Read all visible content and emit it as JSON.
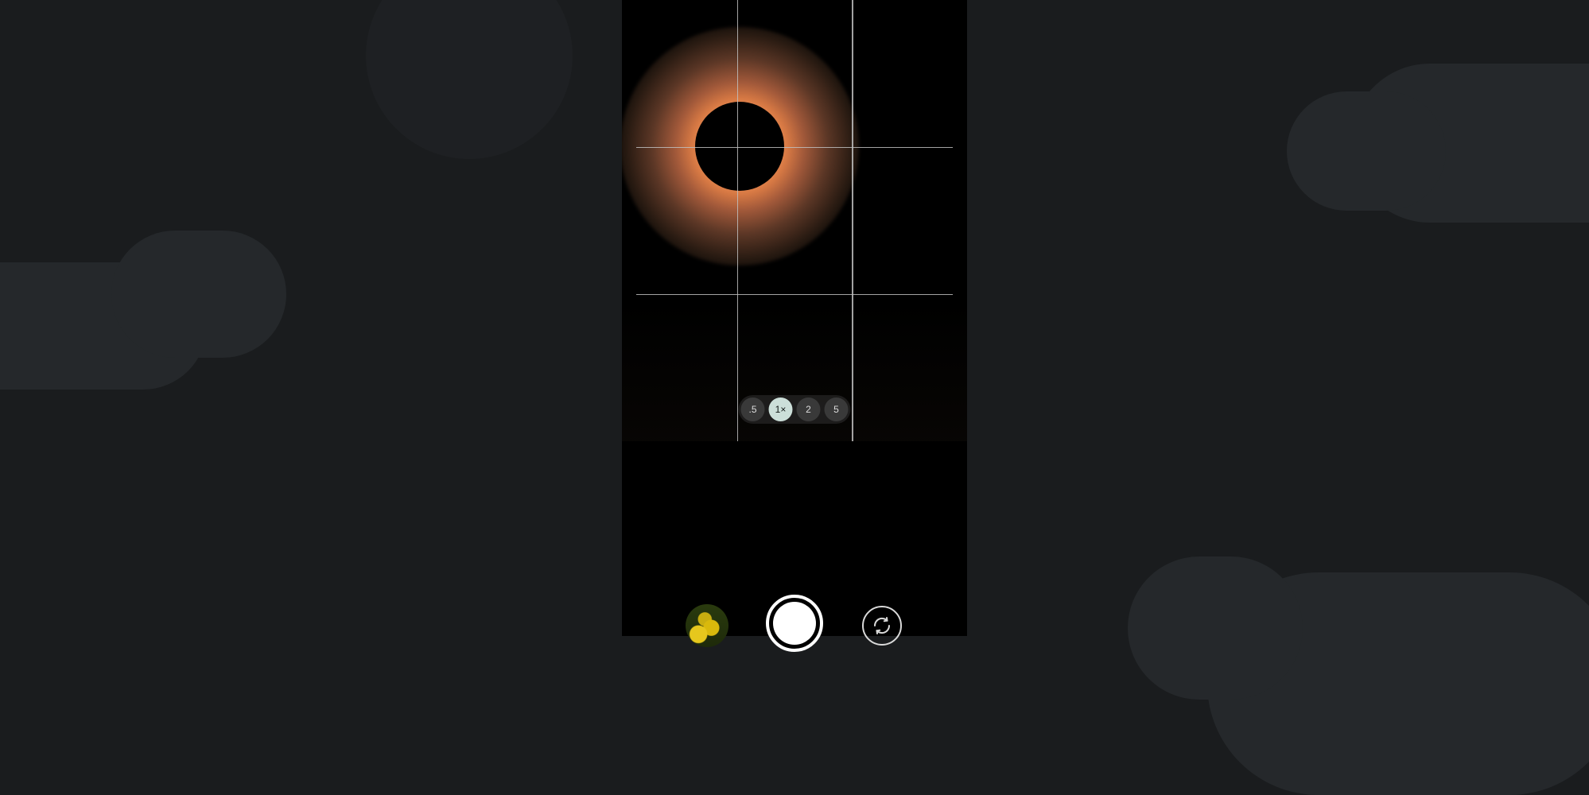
{
  "viewfinder": {
    "subject": "solar-eclipse",
    "grid_enabled": true
  },
  "zoom": {
    "options": [
      {
        "label": ".5",
        "value": 0.5,
        "active": false
      },
      {
        "label": "1×",
        "value": 1,
        "active": true
      },
      {
        "label": "2",
        "value": 2,
        "active": false
      },
      {
        "label": "5",
        "value": 5,
        "active": false
      }
    ]
  },
  "controls": {
    "gallery_thumbnail": "last-photo",
    "shutter": "capture-photo",
    "switch_camera": "flip-camera"
  }
}
